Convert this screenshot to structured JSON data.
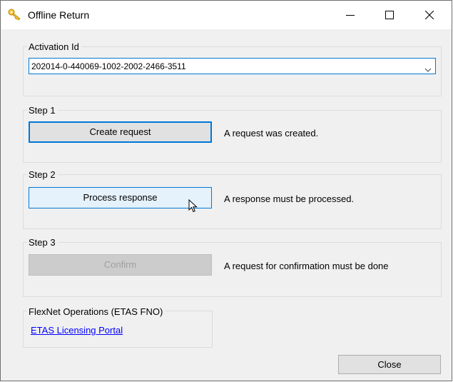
{
  "window": {
    "title": "Offline Return",
    "icons": {
      "app": "key-icon",
      "minimize": "minimize-icon",
      "maximize": "maximize-icon",
      "close": "close-icon"
    }
  },
  "activation": {
    "label": "Activation Id",
    "value": "202014-0-440069-1002-2002-2466-3511"
  },
  "step1": {
    "label": "Step 1",
    "button": "Create request",
    "status": "A request was created."
  },
  "step2": {
    "label": "Step 2",
    "button": "Process response",
    "status": "A response must be processed."
  },
  "step3": {
    "label": "Step 3",
    "button": "Confirm",
    "status": "A request for confirmation must be done"
  },
  "flexnet": {
    "label": "FlexNet Operations (ETAS FNO)",
    "link": "ETAS Licensing Portal"
  },
  "footer": {
    "close": "Close"
  },
  "colors": {
    "accent": "#0078d7",
    "link": "#0000ff",
    "background": "#f0f0f0"
  }
}
